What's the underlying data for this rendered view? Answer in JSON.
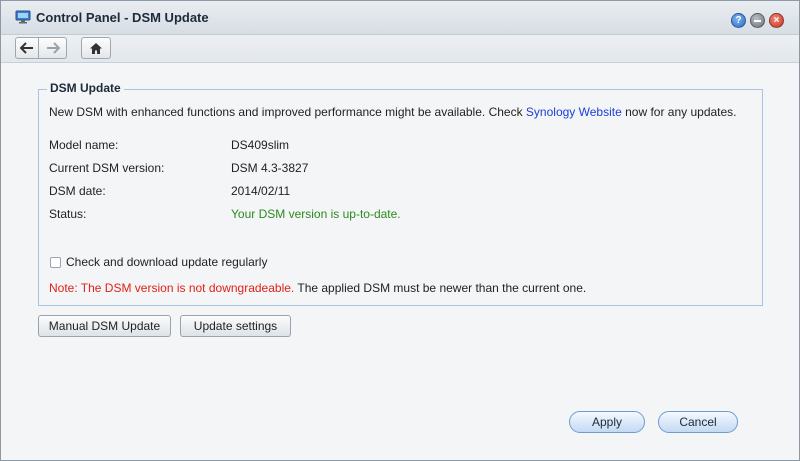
{
  "window": {
    "title": "Control Panel - DSM Update"
  },
  "title_buttons": {
    "help": "?",
    "minimize": "",
    "close": "×"
  },
  "section": {
    "legend": "DSM Update",
    "intro_before": "New DSM with enhanced functions and improved performance might be available. Check",
    "intro_link": "Synology Website",
    "intro_after": "now for any updates.",
    "fields": [
      {
        "label": "Model name:",
        "value": "DS409slim"
      },
      {
        "label": "Current DSM version:",
        "value": "DSM 4.3-3827"
      },
      {
        "label": "DSM date:",
        "value": "2014/02/11"
      },
      {
        "label": "Status:",
        "value": "Your DSM version is up-to-date."
      }
    ],
    "checkbox_label": "Check and download update regularly",
    "checkbox_checked": false,
    "note_red": "Note: The DSM version is not downgradeable.",
    "note_rest": "The applied DSM must be newer than the current one."
  },
  "buttons": {
    "manual_update": "Manual DSM Update",
    "update_settings": "Update settings",
    "apply": "Apply",
    "cancel": "Cancel"
  },
  "icons": {
    "back": "arrow-left-icon",
    "forward": "arrow-right-icon",
    "home": "home-icon",
    "app": "control-panel-icon"
  },
  "colors": {
    "link": "#1a3fd6",
    "status_ok": "#2b8a1e",
    "warning": "#e0211a",
    "fieldset_border": "#aac4e0"
  }
}
